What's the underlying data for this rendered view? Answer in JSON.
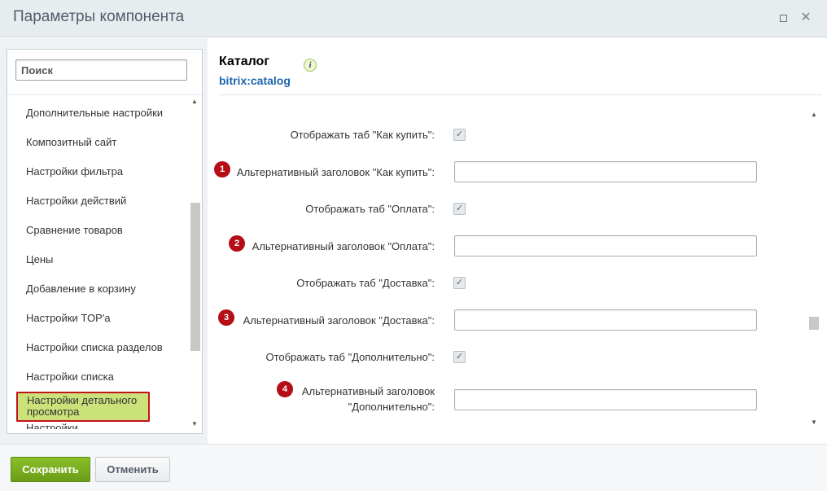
{
  "window": {
    "title": "Параметры компонента",
    "maximize_icon": "maximize-icon",
    "close_icon": "close-icon",
    "close_glyph": "✕"
  },
  "sidebar": {
    "search_placeholder": "Поиск",
    "items": [
      {
        "label": "Дополнительные настройки"
      },
      {
        "label": "Композитный сайт"
      },
      {
        "label": "Настройки фильтра"
      },
      {
        "label": "Настройки действий"
      },
      {
        "label": "Сравнение товаров"
      },
      {
        "label": "Цены"
      },
      {
        "label": "Добавление в корзину"
      },
      {
        "label": "Настройки TOP'а"
      },
      {
        "label": "Настройки списка разделов"
      },
      {
        "label": "Настройки списка"
      },
      {
        "label": "Настройки детального просмотра",
        "active": true
      },
      {
        "label": "Настройки ..."
      }
    ]
  },
  "component": {
    "title": "Каталог",
    "code": "bitrix:catalog",
    "info_glyph": "i"
  },
  "form": {
    "rows": [
      {
        "type": "checkbox",
        "label": "Отображать таб \"Как купить\":",
        "checked": true
      },
      {
        "type": "text",
        "badge": "1",
        "label": "Альтернативный заголовок \"Как купить\":",
        "value": ""
      },
      {
        "type": "checkbox",
        "label": "Отображать таб \"Оплата\":",
        "checked": true
      },
      {
        "type": "text",
        "badge": "2",
        "label": "Альтернативный заголовок \"Оплата\":",
        "value": ""
      },
      {
        "type": "checkbox",
        "label": "Отображать таб \"Доставка\":",
        "checked": true
      },
      {
        "type": "text",
        "badge": "3",
        "label": "Альтернативный заголовок \"Доставка\":",
        "value": ""
      },
      {
        "type": "checkbox",
        "label": "Отображать таб \"Дополнительно\":",
        "checked": true
      },
      {
        "type": "text",
        "badge": "4",
        "label_line1": "Альтернативный заголовок",
        "label_line2": "\"Дополнительно\":",
        "value": ""
      }
    ],
    "check_glyph": "✓"
  },
  "footer": {
    "save_label": "Сохранить",
    "cancel_label": "Отменить"
  },
  "scroll": {
    "up_glyph": "▲",
    "down_glyph": "▼"
  },
  "colors": {
    "accent_green": "#74a81f",
    "active_item_bg": "#cbe17a",
    "highlight_red": "#c3141b",
    "badge_red": "#b50e17",
    "link_blue": "#2066b0"
  }
}
